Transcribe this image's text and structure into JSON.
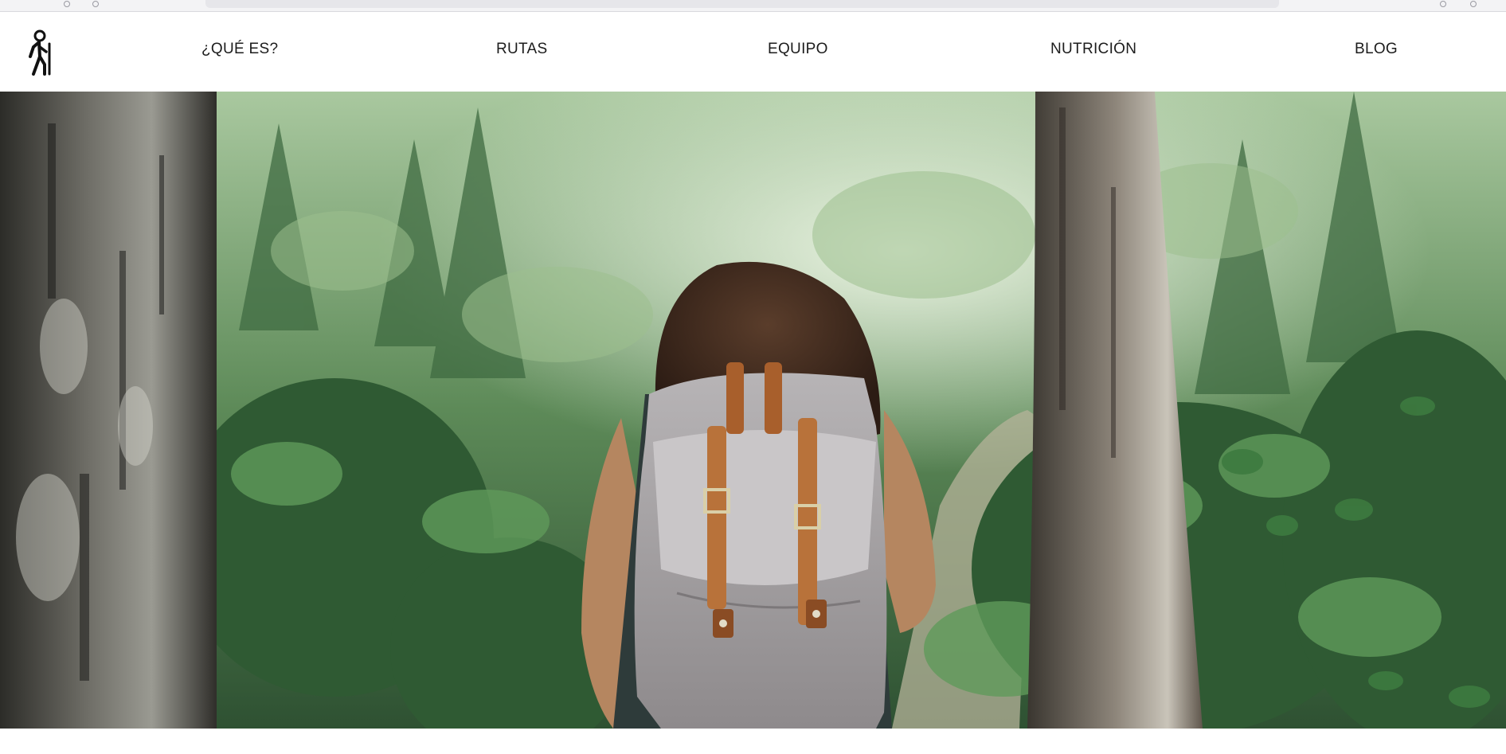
{
  "header": {
    "logo_icon": "hiker-icon",
    "nav": [
      {
        "label": "¿QUÉ ES?"
      },
      {
        "label": "RUTAS"
      },
      {
        "label": "EQUIPO"
      },
      {
        "label": "NUTRICIÓN"
      },
      {
        "label": "BLOG"
      }
    ]
  },
  "hero": {
    "image_icon": "hiker-in-forest-photo"
  },
  "colors": {
    "nav_text": "#1c1c1c",
    "forest_dark": "#1e3a24",
    "forest_mid": "#4f7d4d",
    "forest_light": "#cfe3c5",
    "backpack": "#a9a6a8",
    "strap": "#b8723a"
  }
}
